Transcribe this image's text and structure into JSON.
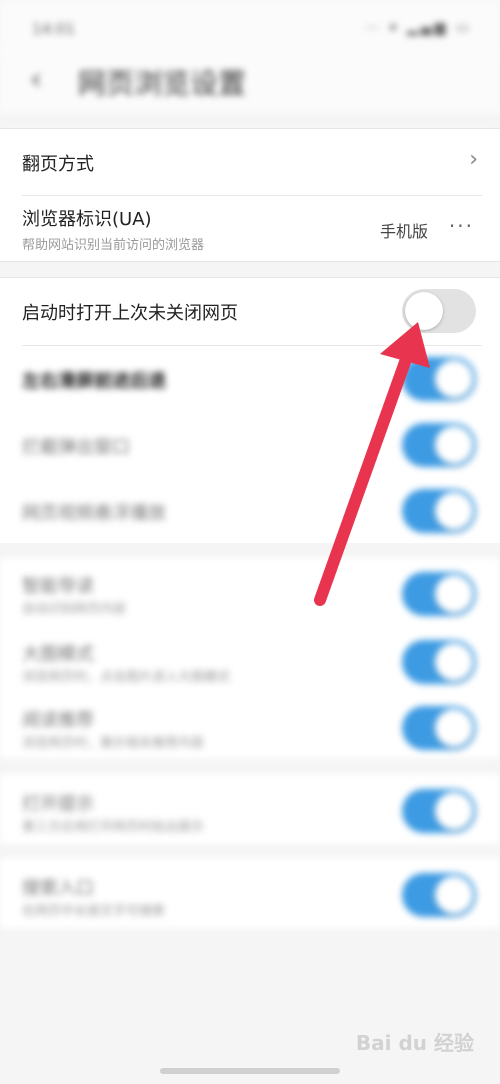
{
  "status_bar": {
    "time": "14:01",
    "icons": "⋯ ▾ ▂▄▆ ▭"
  },
  "header": {
    "title": "网页浏览设置"
  },
  "settings": {
    "page_turn": {
      "label": "翻页方式"
    },
    "user_agent": {
      "label": "浏览器标识(UA)",
      "sub": "帮助网站识别当前访问的浏览器",
      "value": "手机版"
    },
    "restore_tabs": {
      "label": "启动时打开上次未关闭网页",
      "enabled": false
    }
  },
  "blurred_rows": [
    {
      "label": "左右滑屏前进后退",
      "sub": "",
      "enabled": true
    },
    {
      "label": "拦截弹出窗口",
      "sub": "",
      "enabled": true
    },
    {
      "label": "网页视频悬浮播放",
      "sub": "",
      "enabled": true
    },
    {
      "label": "智能导读",
      "sub": "自动识别网页内容",
      "enabled": true
    },
    {
      "label": "大图模式",
      "sub": "浏览网页时，点击图片进入大图模式",
      "enabled": true
    },
    {
      "label": "阅读推荐",
      "sub": "浏览网页时，展示相关推荐内容",
      "enabled": true
    },
    {
      "label": "打开提示",
      "sub": "第三方应用打开网页时给出提示",
      "enabled": true
    },
    {
      "label": "搜索入口",
      "sub": "在网页中长按文字可搜索",
      "enabled": true
    }
  ],
  "watermark": "Bai du 经验",
  "colors": {
    "toggle_on": "#3d9be3",
    "toggle_off": "#e2e2e2",
    "arrow": "#e8344e"
  }
}
